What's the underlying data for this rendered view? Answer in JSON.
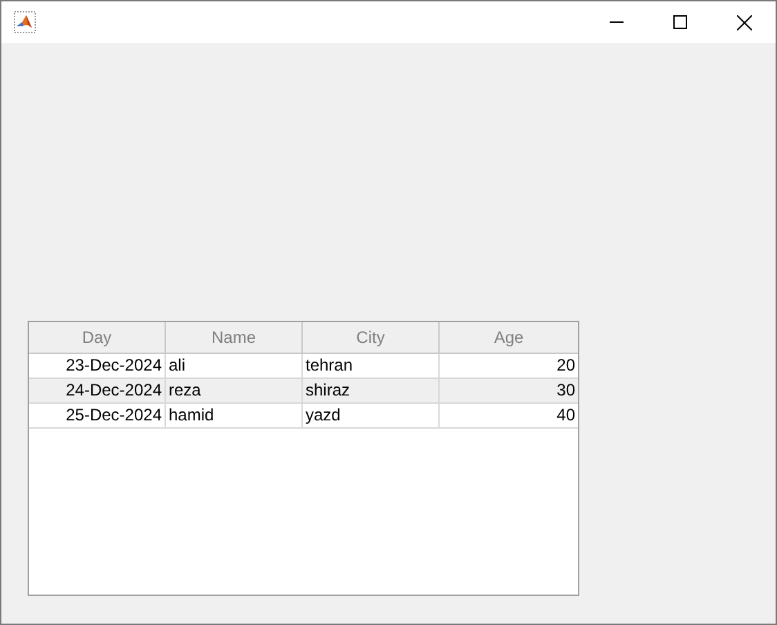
{
  "table": {
    "columns": [
      {
        "label": "Day",
        "kind": "date"
      },
      {
        "label": "Name",
        "kind": "text"
      },
      {
        "label": "City",
        "kind": "text"
      },
      {
        "label": "Age",
        "kind": "number"
      }
    ],
    "rows": [
      [
        "23-Dec-2024",
        "ali",
        "tehran",
        "20"
      ],
      [
        "24-Dec-2024",
        "reza",
        "shiraz",
        "30"
      ],
      [
        "25-Dec-2024",
        "hamid",
        "yazd",
        "40"
      ]
    ]
  }
}
